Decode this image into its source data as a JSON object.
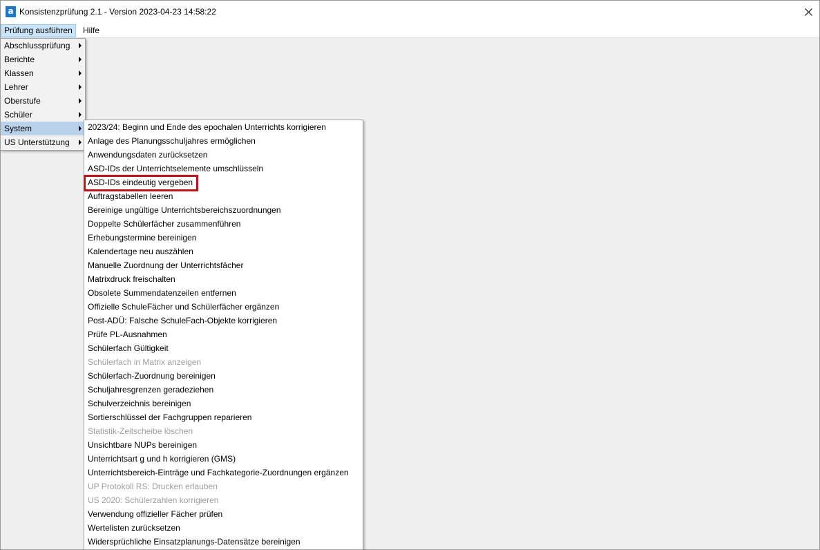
{
  "window": {
    "title": "Konsistenzprüfung 2.1 - Version 2023-04-23 14:58:22",
    "app_icon_letter": "a",
    "close_glyph": "✕",
    "accent_color": "#1d79c8"
  },
  "menubar": {
    "items": [
      {
        "label": "Prüfung ausführen",
        "active": true
      },
      {
        "label": "Hilfe",
        "active": false
      }
    ]
  },
  "main_menu": {
    "items": [
      {
        "label": "Abschlussprüfung",
        "has_submenu": true
      },
      {
        "label": "Berichte",
        "has_submenu": true
      },
      {
        "label": "Klassen",
        "has_submenu": true
      },
      {
        "label": "Lehrer",
        "has_submenu": true
      },
      {
        "label": "Oberstufe",
        "has_submenu": true
      },
      {
        "label": "Schüler",
        "has_submenu": true
      },
      {
        "label": "System",
        "has_submenu": true,
        "selected": true
      },
      {
        "label": "US Unterstützung",
        "has_submenu": true
      }
    ]
  },
  "system_submenu": {
    "highlighted_item": "ASD-IDs eindeutig vergeben",
    "highlight_color": "#c0141b",
    "items": [
      {
        "label": "2023/24: Beginn und Ende des epochalen Unterrichts korrigieren",
        "enabled": true
      },
      {
        "label": "Anlage des Planungsschuljahres ermöglichen",
        "enabled": true
      },
      {
        "label": "Anwendungsdaten zurücksetzen",
        "enabled": true
      },
      {
        "label": "ASD-IDs der Unterrichtselemente umschlüsseln",
        "enabled": true
      },
      {
        "label": "ASD-IDs eindeutig vergeben",
        "enabled": true
      },
      {
        "label": "Auftragstabellen leeren",
        "enabled": true
      },
      {
        "label": "Bereinige ungültige Unterrichtsbereichszuordnungen",
        "enabled": true
      },
      {
        "label": "Doppelte Schülerfächer zusammenführen",
        "enabled": true
      },
      {
        "label": "Erhebungstermine bereinigen",
        "enabled": true
      },
      {
        "label": "Kalendertage neu auszählen",
        "enabled": true
      },
      {
        "label": "Manuelle Zuordnung der Unterrichtsfächer",
        "enabled": true
      },
      {
        "label": "Matrixdruck freischalten",
        "enabled": true
      },
      {
        "label": "Obsolete Summendatenzeilen entfernen",
        "enabled": true
      },
      {
        "label": "Offizielle SchuleFächer und Schülerfächer ergänzen",
        "enabled": true
      },
      {
        "label": "Post-ADÜ: Falsche SchuleFach-Objekte korrigieren",
        "enabled": true
      },
      {
        "label": "Prüfe PL-Ausnahmen",
        "enabled": true
      },
      {
        "label": "Schülerfach Gültigkeit",
        "enabled": true
      },
      {
        "label": "Schülerfach in Matrix anzeigen",
        "enabled": false
      },
      {
        "label": "Schülerfach-Zuordnung bereinigen",
        "enabled": true
      },
      {
        "label": "Schuljahresgrenzen geradeziehen",
        "enabled": true
      },
      {
        "label": "Schulverzeichnis bereinigen",
        "enabled": true
      },
      {
        "label": "Sortierschlüssel der Fachgruppen reparieren",
        "enabled": true
      },
      {
        "label": "Statistik-Zeitscheibe löschen",
        "enabled": false
      },
      {
        "label": "Unsichtbare NUPs bereinigen",
        "enabled": true
      },
      {
        "label": "Unterrichtsart g und h korrigieren (GMS)",
        "enabled": true
      },
      {
        "label": "Unterrichtsbereich-Einträge und Fachkategorie-Zuordnungen ergänzen",
        "enabled": true
      },
      {
        "label": "UP Protokoll RS: Drucken erlauben",
        "enabled": false
      },
      {
        "label": "US 2020: Schülerzahlen korrigieren",
        "enabled": false
      },
      {
        "label": "Verwendung offizieller Fächer prüfen",
        "enabled": true
      },
      {
        "label": "Wertelisten zurücksetzen",
        "enabled": true
      },
      {
        "label": "Widersprüchliche Einsatzplanungs-Datensätze bereinigen",
        "enabled": true
      }
    ]
  }
}
